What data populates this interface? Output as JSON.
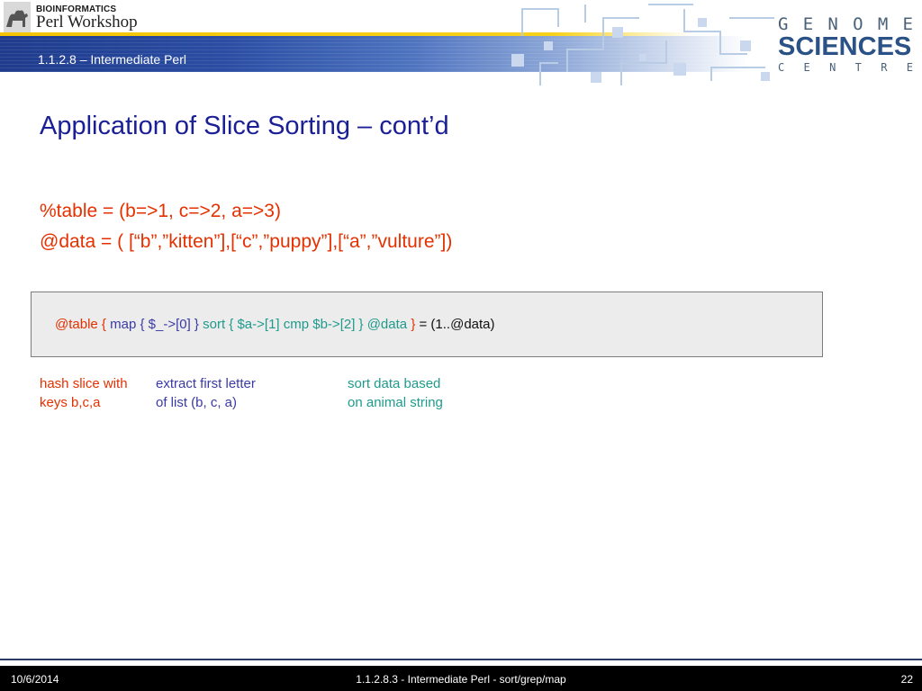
{
  "header": {
    "logo_top": "BIOINFORMATICS",
    "logo_bottom": "Perl Workshop",
    "course_label": "1.1.2.8 – Intermediate Perl",
    "gsc_top": [
      "G",
      "E",
      "N",
      "O",
      "M",
      "E"
    ],
    "gsc_mid": "SCIENCES",
    "gsc_bottom": [
      "C",
      "E",
      "N",
      "T",
      "R",
      "E"
    ]
  },
  "slide": {
    "title": "Application of Slice Sorting – cont’d",
    "code_line_1": "%table = (b=>1, c=>2, a=>3)",
    "code_line_2": "@data = ( [“b”,”kitten”],[“c”,”puppy”],[“a”,”vulture”])",
    "code_box": {
      "part_hash": "@table {",
      "part_map": "map { $_->[0] }",
      "part_sort": "sort { $a->[1] cmp $b->[2] } @data",
      "part_close": "}",
      "part_assign": "= (1..@data)"
    },
    "annotations": [
      {
        "line1": "hash slice with",
        "line2": "keys b,c,a"
      },
      {
        "line1": "extract first letter",
        "line2": "of list (b, c, a)"
      },
      {
        "line1": "sort data based",
        "line2": "on animal string"
      }
    ]
  },
  "footer": {
    "date": "10/6/2014",
    "center": "1.1.2.8.3 - Intermediate Perl - sort/grep/map",
    "page": "22"
  },
  "colors": {
    "title": "#1a1f96",
    "code_red": "#e53000",
    "code_blue": "#3a3aa6",
    "code_teal": "#1f9a8c",
    "header_blue": "#1f3b8c",
    "header_yellow": "#f4c400",
    "footer": "#000000"
  },
  "icons": [
    "camel-logo-icon",
    "circuit-pattern-icon"
  ]
}
